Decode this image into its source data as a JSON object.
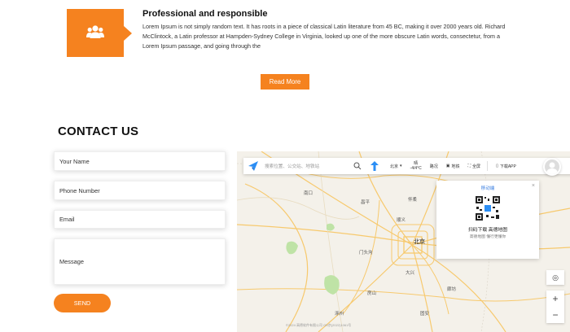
{
  "feature": {
    "title": "Professional and responsible",
    "text": "Lorem Ipsum is not simply random text. It has roots in a piece of classical Latin literature from 45 BC, making it over 2000 years old. Richard McClintock, a Latin professor at Hampden-Sydney College in Virginia, looked up one of the more obscure Latin words, consectetur, from a Lorem Ipsum passage, and going through the",
    "icon": "users-icon"
  },
  "read_more_label": "Read More",
  "contact": {
    "title": "CONTACT US",
    "name_placeholder": "Your Name",
    "phone_placeholder": "Phone Number",
    "email_placeholder": "Email",
    "message_placeholder": "Message",
    "send_label": "SEND"
  },
  "map": {
    "search_placeholder": "搜索位置、公交站、地铁站",
    "city": "北京",
    "weather_cond": "晴",
    "weather_temp": "-4/4°C",
    "tools": [
      "路况",
      "地铁",
      "全屏"
    ],
    "download_app": "下载APP",
    "qr": {
      "title": "移动端",
      "caption": "扫码下载 高德地图",
      "sub": "高德地图 懂行更懂你"
    },
    "labels": {
      "beijing": "北京",
      "langfang": "廊坊",
      "l1": "南口",
      "l2": "昌平",
      "l3": "怀柔",
      "l4": "门头沟",
      "l5": "大兴",
      "l6": "涿州",
      "l7": "固安",
      "l8": "通州",
      "l9": "顺义",
      "l10": "房山"
    },
    "footer": "©2024 高德软件有限公司 GS京(2022)1061号"
  },
  "colors": {
    "accent": "#f5821f",
    "link": "#3b7fe0"
  }
}
